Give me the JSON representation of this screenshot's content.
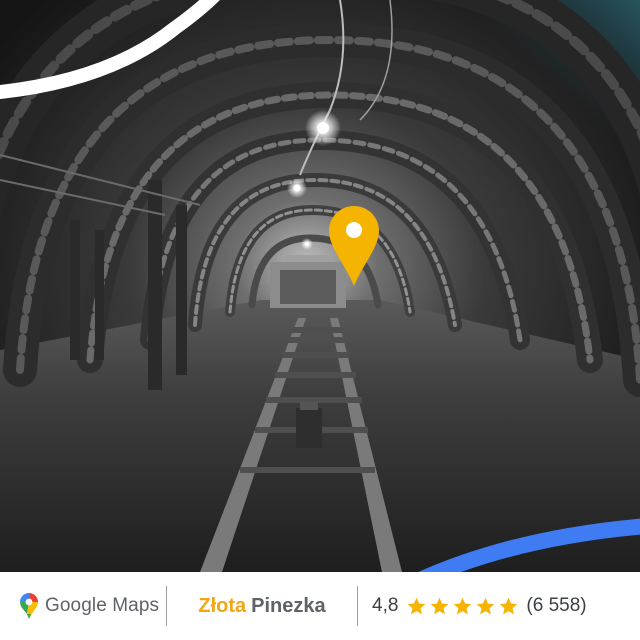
{
  "footer": {
    "brand": {
      "label": "Google Maps",
      "icon": "google-maps-pin-icon"
    },
    "award": {
      "highlight": "Złota",
      "rest": "Pinezka"
    },
    "rating": {
      "value": "4,8",
      "stars": 5,
      "star_icon": "star-icon",
      "count": "(6 558)"
    }
  },
  "photo": {
    "subject": "mine-tunnel",
    "pin_icon": "map-pin-icon"
  },
  "colors": {
    "gold": "#f3a614",
    "brand_text": "#5f6368",
    "accent_blue": "#3f7bf2",
    "pin": "#f4b400",
    "star": "#f4b400"
  }
}
